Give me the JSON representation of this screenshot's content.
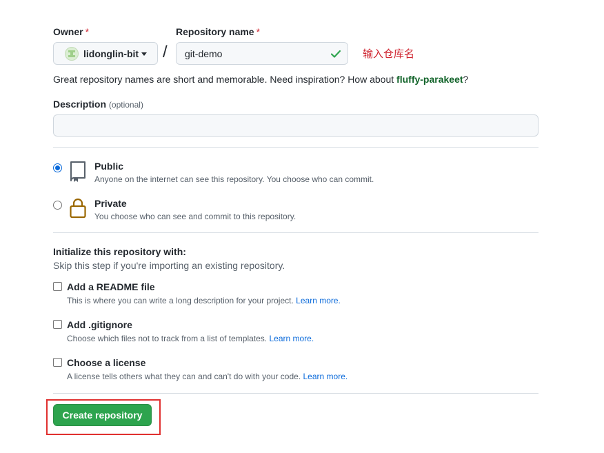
{
  "owner": {
    "label": "Owner",
    "required_mark": "*",
    "value": "lidonglin-bit"
  },
  "separator": "/",
  "repo_name": {
    "label": "Repository name",
    "required_mark": "*",
    "value": "git-demo",
    "valid": true
  },
  "annotation": "输入仓库名",
  "hint": {
    "prefix": "Great repository names are short and memorable. Need inspiration? How about ",
    "suggestion": "fluffy-parakeet",
    "suffix": "?"
  },
  "description": {
    "label": "Description",
    "optional": "(optional)",
    "value": ""
  },
  "visibility": {
    "selected": "public",
    "options": [
      {
        "id": "public",
        "title": "Public",
        "desc": "Anyone on the internet can see this repository. You choose who can commit."
      },
      {
        "id": "private",
        "title": "Private",
        "desc": "You choose who can see and commit to this repository."
      }
    ]
  },
  "initialize": {
    "title": "Initialize this repository with:",
    "subtitle": "Skip this step if you're importing an existing repository.",
    "items": [
      {
        "title": "Add a README file",
        "desc": "This is where you can write a long description for your project.",
        "link": "Learn more.",
        "checked": false
      },
      {
        "title": "Add .gitignore",
        "desc": "Choose which files not to track from a list of templates.",
        "link": "Learn more.",
        "checked": false
      },
      {
        "title": "Choose a license",
        "desc": "A license tells others what they can and can't do with your code.",
        "link": "Learn more.",
        "checked": false
      }
    ]
  },
  "create_button": "Create repository",
  "colors": {
    "primary_button": "#2da44e",
    "link": "#0969da",
    "required": "#cf222e",
    "annotation": "#cf222e",
    "highlight_box": "#e0302f",
    "valid_check": "#2da44e",
    "private_lock": "#9a6700"
  }
}
